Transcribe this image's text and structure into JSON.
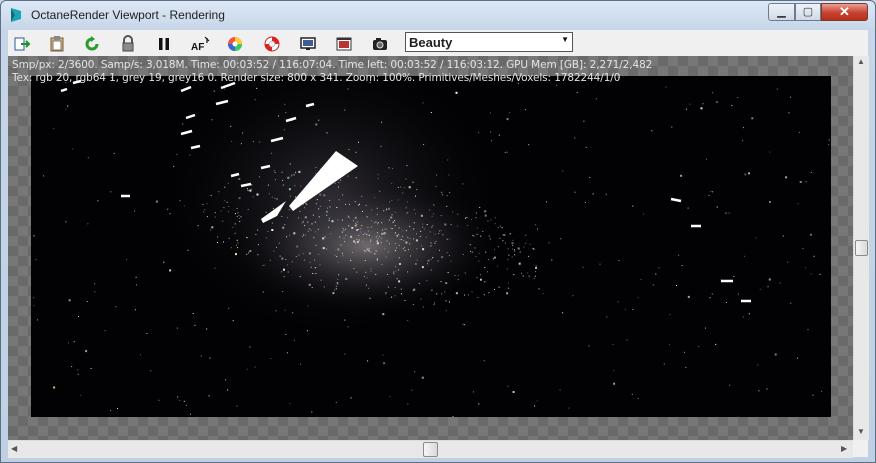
{
  "window": {
    "title": "OctaneRender Viewport - Rendering",
    "controls": {
      "minimize_icon": "minimize-icon",
      "maximize_icon": "maximize-icon",
      "close_icon": "close-icon"
    }
  },
  "toolbar": {
    "buttons": [
      {
        "icon": "send-scene-icon"
      },
      {
        "icon": "clipboard-icon"
      },
      {
        "icon": "restart-render-icon"
      },
      {
        "icon": "lock-icon"
      },
      {
        "icon": "pause-icon"
      },
      {
        "icon": "autofocus-icon"
      },
      {
        "icon": "color-picker-icon"
      },
      {
        "icon": "lifebuoy-icon"
      },
      {
        "icon": "monitor-icon"
      },
      {
        "icon": "save-image-icon"
      },
      {
        "icon": "camera-icon"
      }
    ],
    "pass_select": {
      "value": "Beauty"
    }
  },
  "status": {
    "line1": "Smp/px: 2/3600.   Samp/s: 3,018M.   Time: 00:03:52 / 116:07:04.   Time left: 00:03:52 / 116:03:12.   GPU Mem [GB]: 2,271/2,482",
    "line2": "Tex: rgb 20, rgb64 1, grey 19, grey16 0.   Render size: 800 x 341.   Zoom: 100%.   Primitives/Meshes/Voxels: 1782244/1/0"
  },
  "colors": {
    "render_bg": "#020205",
    "checker_dark": "#6a6a6a",
    "checker_light": "#777777"
  }
}
